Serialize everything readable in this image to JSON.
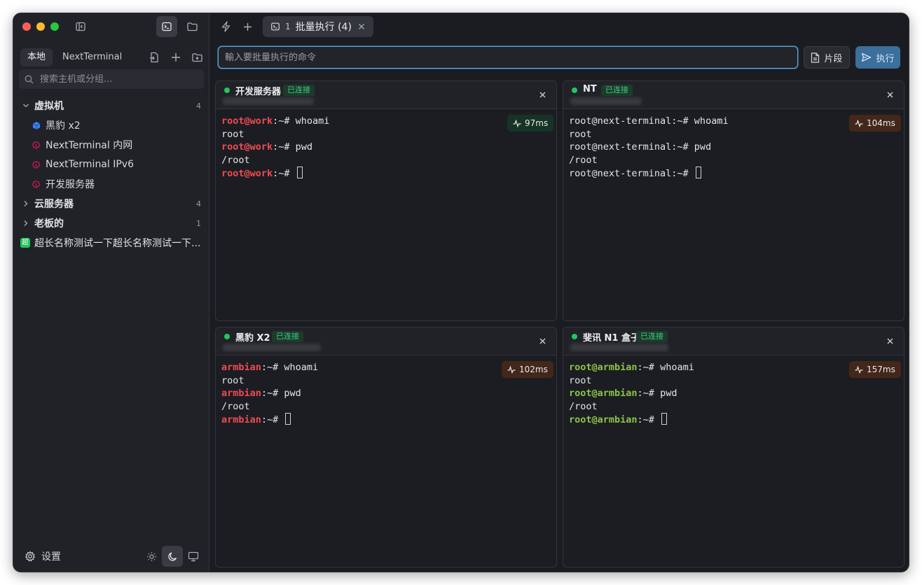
{
  "sidebar": {
    "source_tabs": [
      "本地",
      "NextTerminal"
    ],
    "search_placeholder": "搜索主机或分组...",
    "groups": [
      {
        "label": "虚拟机",
        "count": "4",
        "expanded": true,
        "hosts": [
          {
            "label": "黑豹 x2",
            "icon": "cube-icon"
          },
          {
            "label": "NextTerminal 内网",
            "icon": "debian-icon"
          },
          {
            "label": "NextTerminal IPv6",
            "icon": "debian-icon"
          },
          {
            "label": "开发服务器",
            "icon": "debian-icon"
          }
        ]
      },
      {
        "label": "云服务器",
        "count": "4",
        "expanded": false
      },
      {
        "label": "老板的",
        "count": "1",
        "expanded": false
      }
    ],
    "root_host": {
      "badge": "超",
      "label": "超长名称测试一下超长名称测试一下..."
    },
    "settings_label": "设置"
  },
  "topbar": {
    "tab": {
      "number": "1",
      "title": "批量执行 (4)"
    }
  },
  "command": {
    "placeholder": "輸入要批量执行的命令",
    "snippet_label": "片段",
    "exec_label": "执行"
  },
  "colors": {
    "accent": "#3b6f9c",
    "online": "#22c55e",
    "prompt_red": "#ee4b52",
    "prompt_green": "#8bc34a"
  },
  "sessions": [
    {
      "name": "开发服务器",
      "status": "已连接",
      "latency": "97ms",
      "latency_level": "good",
      "prompt": "root@work",
      "prompt_color": "red",
      "lines": [
        {
          "prompt": "root@work",
          "sep": ":~# ",
          "text": "whoami"
        },
        {
          "prompt": "",
          "sep": "",
          "text": "root"
        },
        {
          "prompt": "root@work",
          "sep": ":~# ",
          "text": "pwd"
        },
        {
          "prompt": "",
          "sep": "",
          "text": "/root"
        },
        {
          "prompt": "root@work",
          "sep": ":~# ",
          "text": "",
          "cursor": true
        }
      ]
    },
    {
      "name": "NT",
      "status": "已连接",
      "latency": "104ms",
      "latency_level": "warn",
      "prompt": "",
      "prompt_color": "none",
      "lines": [
        {
          "prompt": "",
          "sep": "",
          "text": "root@next-terminal:~# whoami"
        },
        {
          "prompt": "",
          "sep": "",
          "text": "root"
        },
        {
          "prompt": "",
          "sep": "",
          "text": "root@next-terminal:~# pwd"
        },
        {
          "prompt": "",
          "sep": "",
          "text": "/root"
        },
        {
          "prompt": "",
          "sep": "",
          "text": "root@next-terminal:~# ",
          "cursor": true
        }
      ]
    },
    {
      "name": "黑豹 X2",
      "status": "已连接",
      "latency": "102ms",
      "latency_level": "warn",
      "prompt": "armbian",
      "prompt_color": "red",
      "lines": [
        {
          "prompt": "armbian",
          "sep": ":~# ",
          "text": "whoami"
        },
        {
          "prompt": "",
          "sep": "",
          "text": "root"
        },
        {
          "prompt": "armbian",
          "sep": ":~# ",
          "text": "pwd"
        },
        {
          "prompt": "",
          "sep": "",
          "text": "/root"
        },
        {
          "prompt": "armbian",
          "sep": ":~# ",
          "text": "",
          "cursor": true
        }
      ]
    },
    {
      "name": "斐讯 N1 盒子",
      "status": "已连接",
      "latency": "157ms",
      "latency_level": "warn",
      "prompt": "root@armbian",
      "prompt_color": "green",
      "lines": [
        {
          "prompt": "root@armbian",
          "sep": ":~# ",
          "text": "whoami"
        },
        {
          "prompt": "",
          "sep": "",
          "text": "root"
        },
        {
          "prompt": "root@armbian",
          "sep": ":~# ",
          "text": "pwd"
        },
        {
          "prompt": "",
          "sep": "",
          "text": "/root"
        },
        {
          "prompt": "root@armbian",
          "sep": ":~# ",
          "text": "",
          "cursor": true
        }
      ]
    }
  ]
}
